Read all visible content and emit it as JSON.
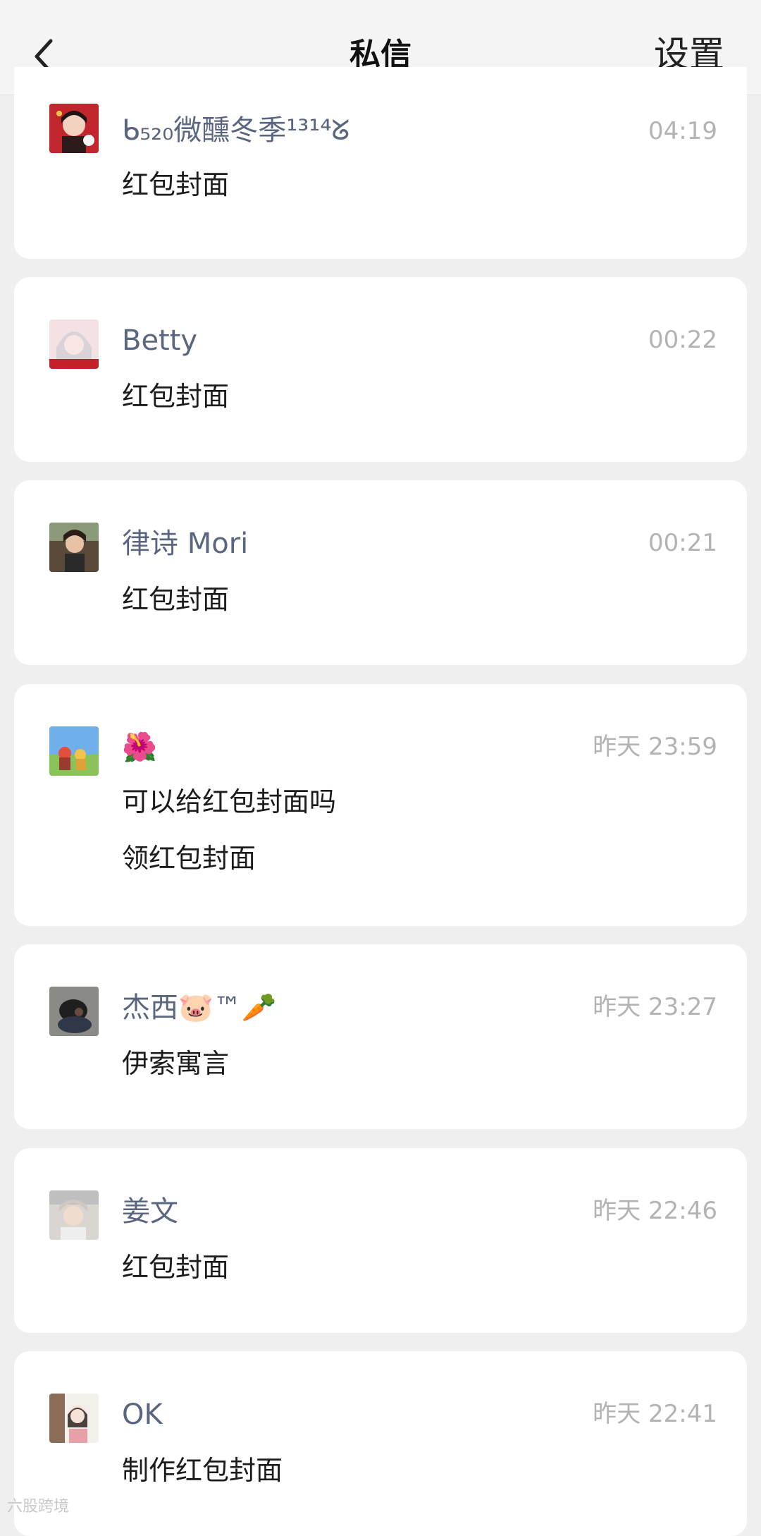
{
  "header": {
    "title": "私信",
    "settings_label": "设置"
  },
  "conversations": [
    {
      "name": "ᑲ₅₂₀微醺冬季¹³¹⁴ᘜ",
      "time": "04:19",
      "messages": [
        "红包封面"
      ],
      "avatar_icon": "avatar-girl-red-icon"
    },
    {
      "name": "Betty",
      "time": "00:22",
      "messages": [
        "红包封面"
      ],
      "avatar_icon": "avatar-anime-girl-icon"
    },
    {
      "name": "律诗 Mori",
      "time": "00:21",
      "messages": [
        "红包封面"
      ],
      "avatar_icon": "avatar-woman-icon"
    },
    {
      "name": "🌺",
      "time": "昨天 23:59",
      "messages": [
        "可以给红包封面吗",
        "领红包封面"
      ],
      "avatar_icon": "avatar-landscape-icon"
    },
    {
      "name": "杰西🐷™🥕",
      "time": "昨天 23:27",
      "messages": [
        "伊索寓言"
      ],
      "avatar_icon": "avatar-dark-icon"
    },
    {
      "name": "姜文",
      "time": "昨天 22:46",
      "messages": [
        "红包封面"
      ],
      "avatar_icon": "avatar-woman-light-icon"
    },
    {
      "name": "OK",
      "time": "昨天 22:41",
      "messages": [
        "制作红包封面"
      ],
      "avatar_icon": "avatar-cartoon-girl-icon"
    }
  ],
  "watermark": "六股跨境",
  "colors": {
    "background": "#efefef",
    "card": "#ffffff",
    "name": "#5a6580",
    "time": "#b3b3b3",
    "message": "#1c1c1c"
  }
}
